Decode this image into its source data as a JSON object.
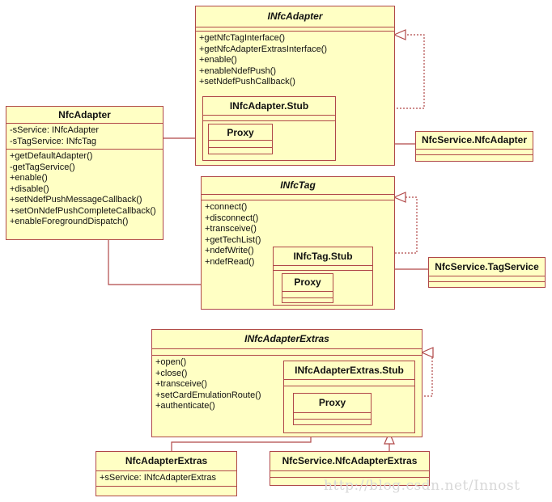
{
  "colors": {
    "fill": "#ffffc4",
    "stroke": "#b04848"
  },
  "infc_adapter": {
    "name": "INfcAdapter",
    "methods": [
      "+getNfcTagInterface()",
      "+getNfcAdapterExtrasInterface()",
      "+enable()",
      "+enableNdefPush()",
      "+setNdefPushCallback()"
    ],
    "stub": "INfcAdapter.Stub",
    "proxy": "Proxy"
  },
  "nfc_adapter": {
    "name": "NfcAdapter",
    "attributes": [
      "-sService: INfcAdapter",
      "-sTagService: INfcTag"
    ],
    "methods": [
      "+getDefaultAdapter()",
      "-getTagService()",
      "+enable()",
      "+disable()",
      "+setNdefPushMessageCallback()",
      "+setOnNdefPushCompleteCallback()",
      "+enableForegroundDispatch()"
    ]
  },
  "nfcservice_nfcadapter": {
    "name": "NfcService.NfcAdapter"
  },
  "infc_tag": {
    "name": "INfcTag",
    "methods": [
      "+connect()",
      "+disconnect()",
      "+transceive()",
      "+getTechList()",
      "+ndefWrite()",
      "+ndefRead()"
    ],
    "stub": "INfcTag.Stub",
    "proxy": "Proxy"
  },
  "nfcservice_tagservice": {
    "name": "NfcService.TagService"
  },
  "infc_adapter_extras": {
    "name": "INfcAdapterExtras",
    "methods": [
      "+open()",
      "+close()",
      "+transceive()",
      "+setCardEmulationRoute()",
      "+authenticate()"
    ],
    "stub": "INfcAdapterExtras.Stub",
    "proxy": "Proxy"
  },
  "nfc_adapter_extras": {
    "name": "NfcAdapterExtras",
    "attributes": [
      "+sService: INfcAdapterExtras"
    ]
  },
  "nfcservice_nfcadapterextras": {
    "name": "NfcService.NfcAdapterExtras"
  },
  "watermark": "http://blog.csdn.net/Innost"
}
